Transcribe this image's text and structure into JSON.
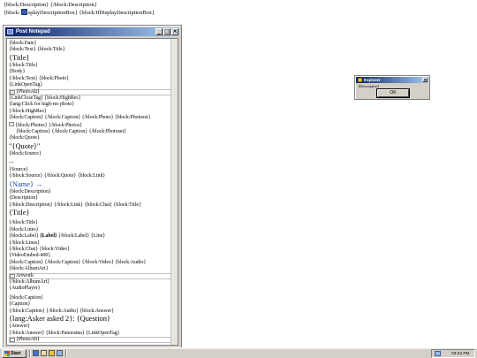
{
  "desktop": {
    "line1": "{block:Description} {/block:Description}",
    "line2_prefix": "{block:",
    "line2_suffix": "splayDescriptionBox} {block:IfDisplayDescriptionBox}"
  },
  "window": {
    "title": "Post Notepad",
    "minimize_label": "_",
    "maximize_label": "□",
    "close_label": "×"
  },
  "content": {
    "lines": [
      "{block:Date}",
      "{block:Text} {block:Title}",
      "{Title}",
      "{/block:Title}",
      "{Body}",
      "{/block:Text} {block:Photo}",
      "{LinkOpenTag}",
      "{PhotoAlt}",
      "{LinkCloseTag} {block:HighRes}",
      "{lang:Click for high-res photo}",
      "{/block:HighRes}",
      "{block:Caption} {/block:Caption} {/block:Photo} {block:Photoset}",
      "{block:Photos} {/block:Photos}",
      "{block:Caption} {/block:Caption} {/block:Photoset}",
      "{block:Quote}",
      "\"{Quote}\"",
      "{block:Source}",
      "—",
      "{Source}",
      "{/block:Source} {/block:Quote} {block:Link}",
      "{Name} →",
      "{block:Description}",
      "{Description}",
      "{/block:Description} {/block:Link} {block:Chat} {block:Title}",
      "{Title}",
      "{/block:Title}",
      "{block:Lines}",
      "{block:Label}",
      "{Label}",
      "{/block:Label} {Line}",
      "{/block:Lines}",
      "{/block:Chat} {block:Video}",
      "{VideoEmbed-400}",
      "{block:Caption} {/block:Caption} {/block:Video} {block:Audio}",
      "{block:AlbumArt}",
      "Artwork",
      "{/block:AlbumArt}",
      "{AudioPlayer}",
      "{block:Caption}",
      "{Caption}",
      "{/block:Caption} {/block:Audio} {block:Answer}",
      "{lang:Asker asked 2}: {Question}",
      "{Answer}",
      "{/block:Answer} {block:Panorama} {LinkOpenTag}",
      "{PhotoAlt}"
    ]
  },
  "dialog": {
    "title": "Explorer",
    "close_label": "×",
    "message": "{Description}",
    "ok_label": "OK"
  },
  "taskbar": {
    "start_label": "Start",
    "clock": "03:34 PM"
  },
  "colors": {
    "title_active": "#0a246a",
    "chrome": "#d4d0c8",
    "link_blue": "#1a3fbf"
  }
}
